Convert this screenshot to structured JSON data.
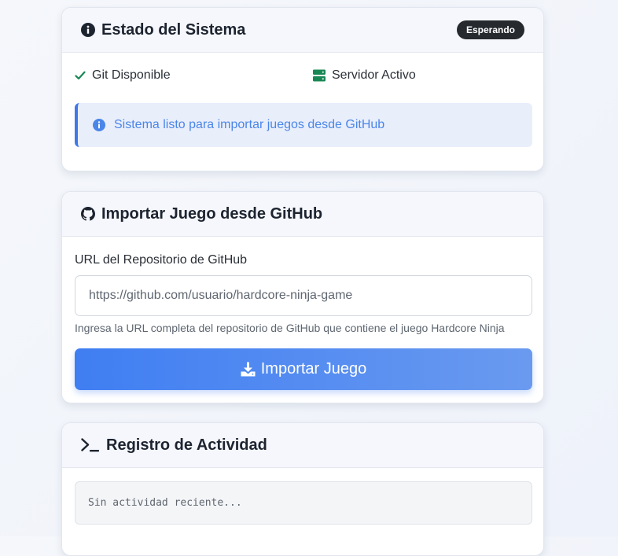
{
  "status_card": {
    "title": "Estado del Sistema",
    "badge": "Esperando",
    "items": [
      {
        "label": "Git Disponible",
        "icon": "check-icon"
      },
      {
        "label": "Servidor Activo",
        "icon": "server-icon"
      }
    ],
    "alert": {
      "icon": "info-icon",
      "text": "Sistema listo para importar juegos desde GitHub"
    }
  },
  "import_card": {
    "title": "Importar Juego desde GitHub",
    "title_icon": "github-icon",
    "field_label": "URL del Repositorio de GitHub",
    "placeholder": "https://github.com/usuario/hardcore-ninja-game",
    "value": "",
    "help": "Ingresa la URL completa del repositorio de GitHub que contiene el juego Hardcore Ninja",
    "button_label": "Importar Juego",
    "button_icon": "download-icon"
  },
  "log_card": {
    "title": "Registro de Actividad",
    "title_icon": "terminal-icon",
    "empty_text": "Sin actividad reciente..."
  },
  "colors": {
    "accent": "#3f7ef2",
    "success": "#198754",
    "badge_bg": "#262a2f",
    "info_text": "#4a86e8"
  }
}
